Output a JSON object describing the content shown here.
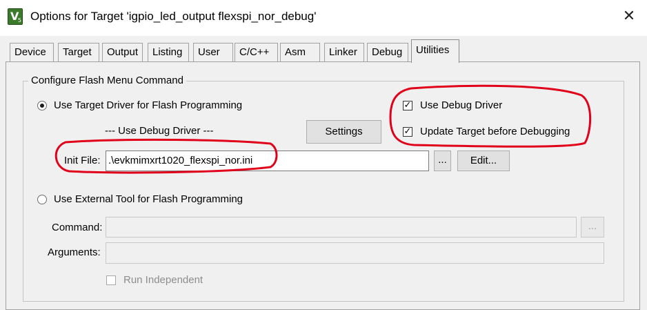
{
  "window": {
    "title": "Options for Target 'igpio_led_output flexspi_nor_debug'",
    "close_glyph": "✕",
    "app_icon_letter": "V",
    "app_icon_sub": "5"
  },
  "tabs": [
    {
      "label": "Device"
    },
    {
      "label": "Target"
    },
    {
      "label": "Output"
    },
    {
      "label": "Listing"
    },
    {
      "label": "User"
    },
    {
      "label": "C/C++"
    },
    {
      "label": "Asm"
    },
    {
      "label": "Linker"
    },
    {
      "label": "Debug"
    },
    {
      "label": "Utilities",
      "active": true
    }
  ],
  "flash": {
    "group_title": "Configure Flash Menu Command",
    "use_target_driver_label": "Use Target Driver for Flash Programming",
    "use_target_driver_selected": true,
    "driver_caption": "--- Use Debug Driver ---",
    "settings_label": "Settings",
    "use_debug_driver_label": "Use Debug Driver",
    "use_debug_driver_checked": true,
    "update_target_label": "Update Target before Debugging",
    "update_target_checked": true,
    "init_file_label": "Init File:",
    "init_file_value": ".\\evkmimxrt1020_flexspi_nor.ini",
    "browse_label": "...",
    "edit_label": "Edit...",
    "use_external_tool_label": "Use External Tool for Flash Programming",
    "use_external_tool_selected": false,
    "command_label": "Command:",
    "command_value": "",
    "command_browse_label": "...",
    "arguments_label": "Arguments:",
    "arguments_value": "",
    "run_independent_label": "Run Independent",
    "run_independent_checked": false
  },
  "annotation_color": "#e0001a",
  "icons": {
    "app": "keil-uvision-icon",
    "close": "close-icon",
    "check": "checkmark-icon"
  }
}
